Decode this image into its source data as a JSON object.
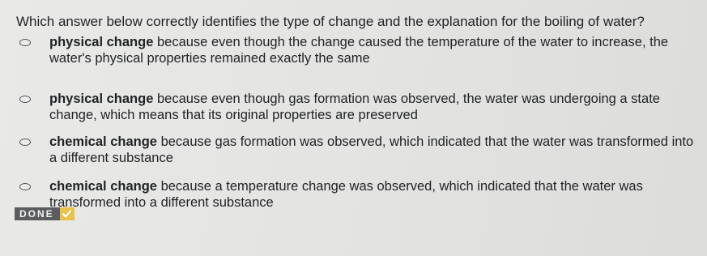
{
  "question": {
    "text": "Which answer below correctly identifies the type of change and the explanation for the boiling of water?"
  },
  "options": [
    {
      "kind": "physical change",
      "explanation": " because even though the change caused the temperature of the water to increase, the water's physical properties remained exactly the same"
    },
    {
      "kind": "physical change",
      "explanation": " because even though gas formation was observed, the water was undergoing a state change, which means that its original properties are preserved"
    },
    {
      "kind": "chemical change",
      "explanation": " because gas formation was observed, which indicated that the water was transformed into a different substance"
    },
    {
      "kind": "chemical change",
      "explanation": " because a temperature change was observed, which indicated that the water was transformed into a different substance"
    }
  ],
  "status": {
    "label": "DONE",
    "icon": "checkmark-icon",
    "color": "#e8c24a"
  }
}
